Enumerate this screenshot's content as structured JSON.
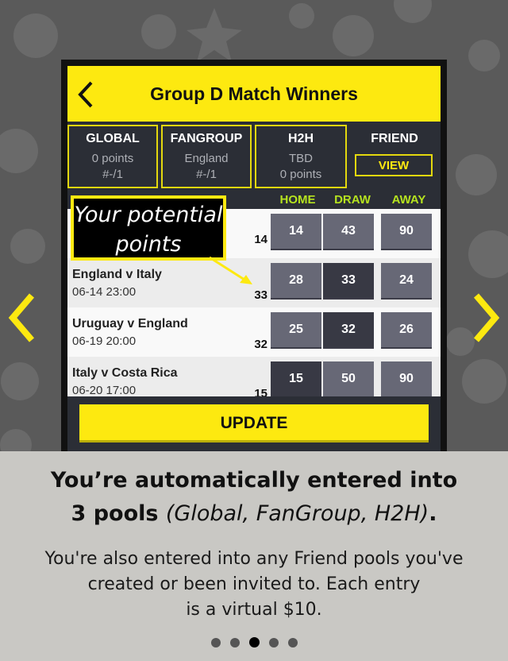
{
  "app": {
    "title": "Group D Match Winners",
    "back_icon": "chevron-left-icon",
    "accent_color": "#fde910"
  },
  "pools": [
    {
      "name": "GLOBAL",
      "line1": "0 points",
      "line2": "#-/1"
    },
    {
      "name": "FANGROUP",
      "line1": "England",
      "line2": "#-/1"
    },
    {
      "name": "H2H",
      "line1": "TBD",
      "line2": "0 points"
    }
  ],
  "friend_pool": {
    "name": "FRIEND",
    "button": "VIEW"
  },
  "columns": [
    "HOME",
    "DRAW",
    "AWAY"
  ],
  "matches": [
    {
      "name": "",
      "date": "",
      "points": "14",
      "home": "14",
      "draw": "43",
      "away": "90",
      "selected": "none"
    },
    {
      "name": "England v Italy",
      "date": "06-14 23:00",
      "points": "33",
      "home": "28",
      "draw": "33",
      "away": "24",
      "selected": "draw"
    },
    {
      "name": "Uruguay v England",
      "date": "06-19 20:00",
      "points": "32",
      "home": "25",
      "draw": "32",
      "away": "26",
      "selected": "draw"
    },
    {
      "name": "Italy v Costa Rica",
      "date": "06-20 17:00",
      "points": "15",
      "home": "15",
      "draw": "50",
      "away": "90",
      "selected": "home"
    }
  ],
  "update_button": "UPDATE",
  "callout": {
    "line1": "Your potential",
    "line2": "points"
  },
  "panel": {
    "headline_line1": "You’re automatically entered into",
    "headline_line2_bold": "3 pools ",
    "headline_line2_italic": "(Global, FanGroup, H2H)",
    "headline_line2_end": ".",
    "body_line1": "You're also entered into any Friend pools you've",
    "body_line2": "created or been invited to.  Each entry",
    "body_line3": "is a virtual $10."
  },
  "pagination": {
    "total": 5,
    "active_index": 2
  },
  "nav": {
    "prev_icon": "chevron-left-icon",
    "next_icon": "chevron-right-icon"
  }
}
